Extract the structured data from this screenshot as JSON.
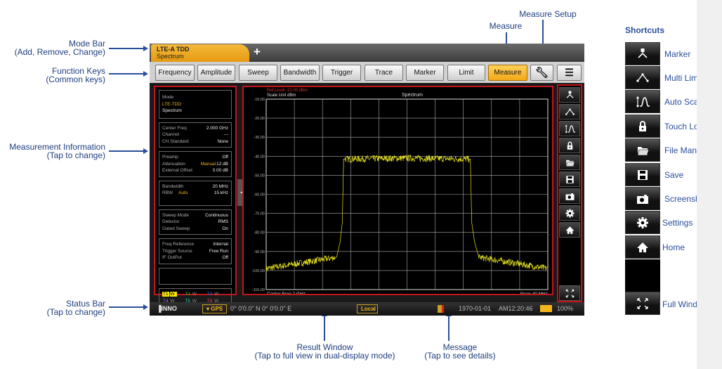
{
  "callouts": {
    "mode_bar": [
      "Mode Bar",
      "(Add, Remove, Change)"
    ],
    "function_keys": [
      "Function Keys",
      "(Common keys)"
    ],
    "measurement_info": [
      "Measurement Information",
      "(Tap to change)"
    ],
    "status_bar": [
      "Status Bar",
      "(Tap to change)"
    ],
    "result_window": [
      "Result Window",
      "(Tap to full view in dual-display mode)"
    ],
    "message": [
      "Message",
      "(Tap to see details)"
    ],
    "measure": "Measure",
    "measure_setup": "Measure Setup"
  },
  "mode_bar": {
    "tab_title": "LTE-A TDD",
    "tab_subtitle": "Spectrum",
    "add_label": "+"
  },
  "function_keys": [
    {
      "label": "Frequency",
      "active": false
    },
    {
      "label": "Amplitude",
      "active": false
    },
    {
      "label": "Sweep",
      "active": false
    },
    {
      "label": "Bandwidth",
      "active": false
    },
    {
      "label": "Trigger",
      "active": false
    },
    {
      "label": "Trace",
      "active": false
    },
    {
      "label": "Marker",
      "active": false
    },
    {
      "label": "Limit",
      "active": false
    },
    {
      "label": "Measure",
      "active": true
    }
  ],
  "function_icons": {
    "measure_setup": "wrench-icon",
    "menu": "list-icon"
  },
  "info": {
    "mode": {
      "label": "Mode",
      "value": "LTE-TDD",
      "sub": "Spectrum"
    },
    "groups": [
      [
        {
          "k": "Center Freq",
          "v": "2.000 GHz"
        },
        {
          "k": "Channel",
          "v": "---"
        },
        {
          "k": "CH Standard",
          "v": "None"
        }
      ],
      [
        {
          "k": "Preamp",
          "v": "Off"
        },
        {
          "k": "Attenuation",
          "m": "Manual",
          "v": "12 dB"
        },
        {
          "k": "External Offset",
          "v": "0.00 dB"
        }
      ],
      [
        {
          "k": "Bandwidth",
          "v": "20 MHz"
        },
        {
          "k": "RBW",
          "m": "Auto",
          "v": "15 kHz"
        }
      ],
      [
        {
          "k": "Sweep Mode",
          "v": "Continuous"
        },
        {
          "k": "Detector",
          "v": "RMS"
        },
        {
          "k": "Gated Sweep",
          "v": "On"
        }
      ],
      [
        {
          "k": "Freq Reference",
          "v": "Internal"
        },
        {
          "k": "Trigger Source",
          "v": "Free Run"
        },
        {
          "k": "IF OutPut",
          "v": "Off"
        }
      ]
    ],
    "traces": [
      {
        "name": "T1",
        "mode": "W",
        "color": "#f5e800",
        "selected": true
      },
      {
        "name": "T2",
        "mode": "W",
        "color": "#2fc23a"
      },
      {
        "name": "T3",
        "mode": "W",
        "color": "#2e6fe0"
      },
      {
        "name": "T4",
        "mode": "W",
        "color": "#9b6be0"
      },
      {
        "name": "T5",
        "mode": "W",
        "color": "#2fd0b0"
      },
      {
        "name": "T6",
        "mode": "W",
        "color": "#e04060"
      }
    ]
  },
  "chart_data": {
    "type": "line",
    "title": "Spectrum",
    "ref_level": "Ref Level -10.00 dBm",
    "scale_unit": "Scale Unit  dBm",
    "xlabel": "Frequency",
    "x_left_label": "Center Freq 2 GHz",
    "x_right_label": "Span  40 MHz",
    "xlim": [
      1.98,
      2.02
    ],
    "ylim": [
      -110,
      -10
    ],
    "yticks": [
      "-10.00",
      "-20.00",
      "-30.00",
      "-40.00",
      "-50.00",
      "-60.00",
      "-70.00",
      "-80.00",
      "-90.00",
      "-100.00",
      "-110.00"
    ],
    "grid": true,
    "trace_color": "#e6e020",
    "series": [
      {
        "x": [
          1.98,
          1.99,
          1.9905,
          1.9908,
          1.991,
          2.0,
          2.009,
          2.0092,
          2.0096,
          2.0102,
          2.02
        ],
        "y": [
          -99,
          -93,
          -85,
          -75,
          -41.5,
          -41,
          -41.5,
          -75,
          -85,
          -93,
          -99
        ]
      }
    ]
  },
  "side_shortcuts": [
    "marker-icon",
    "multi-limit-icon",
    "auto-scale-icon",
    "lock-icon",
    "folder-icon",
    "save-icon",
    "camera-icon",
    "gear-icon",
    "home-icon"
  ],
  "side_full": "full-window-icon",
  "status": {
    "gps": "GPS",
    "coords": "0°  0'0.0\" N 0°  0'0.0\" E",
    "local": "Local",
    "date": "1970-01-01",
    "time": "AM12:20:46",
    "battery": "100%"
  },
  "shortcuts": {
    "title": "Shortcuts",
    "items": [
      {
        "label": "Marker",
        "icon": "marker-icon"
      },
      {
        "label": "Multi Limit",
        "icon": "multi-limit-icon"
      },
      {
        "label": "Auto Scale",
        "icon": "auto-scale-icon"
      },
      {
        "label": "Touch Lock",
        "icon": "lock-icon"
      },
      {
        "label": "File Manager",
        "icon": "folder-icon"
      },
      {
        "label": "Save",
        "icon": "save-icon"
      },
      {
        "label": "Screenshot",
        "icon": "camera-icon"
      },
      {
        "label": "Settings",
        "icon": "gear-icon"
      },
      {
        "label": "Home",
        "icon": "home-icon"
      }
    ],
    "full_window": {
      "label": "Full Window",
      "icon": "full-window-icon"
    }
  }
}
